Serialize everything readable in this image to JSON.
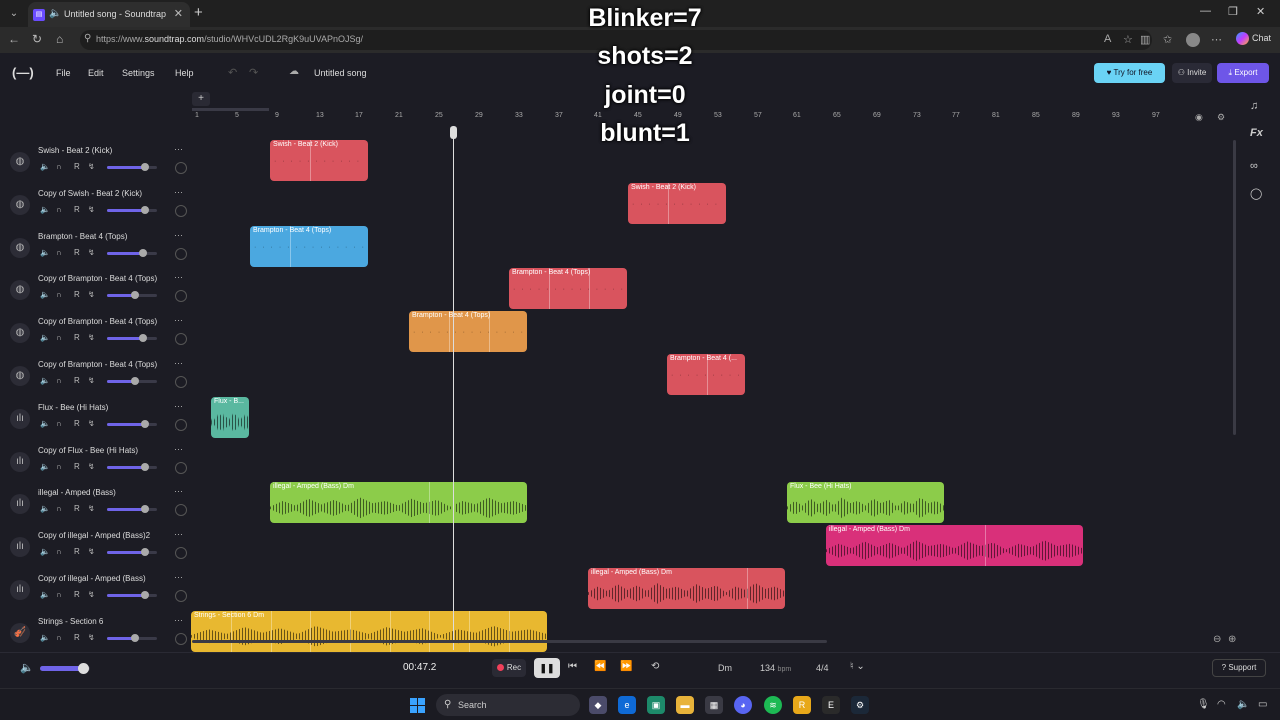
{
  "browser": {
    "tab_title": "Untitled song - Soundtrap",
    "url_prefix": "https://www.",
    "url_host": "soundtrap.com",
    "url_path": "/studio/WHVcUDL2RgK9uUVAPnOJSg/",
    "chat_label": "Chat"
  },
  "app": {
    "logo": "(—)",
    "menu": [
      "File",
      "Edit",
      "Settings",
      "Help"
    ],
    "song_name": "Untitled song",
    "try_free": "Try for free",
    "invite": "Invite",
    "export": "Export"
  },
  "overlay": [
    "Blinker=7",
    "shots=2",
    "joint=0",
    "blunt=1"
  ],
  "ruler": [
    "1",
    "5",
    "9",
    "13",
    "17",
    "21",
    "25",
    "29",
    "33",
    "37",
    "41",
    "45",
    "49",
    "53",
    "57",
    "61",
    "65",
    "69",
    "73",
    "77",
    "81",
    "85",
    "89",
    "93",
    "97"
  ],
  "tracks": [
    {
      "name": "Swish - Beat 2 (Kick)",
      "icon": "drum-icon",
      "volume": 0.75
    },
    {
      "name": "Copy of Swish - Beat 2 (Kick)",
      "icon": "drum-icon",
      "volume": 0.75
    },
    {
      "name": "Brampton - Beat 4 (Tops)",
      "icon": "drum-icon",
      "volume": 0.72
    },
    {
      "name": "Copy of Brampton - Beat 4 (Tops)",
      "icon": "drum-icon",
      "volume": 0.55
    },
    {
      "name": "Copy of Brampton - Beat 4 (Tops)",
      "icon": "drum-icon",
      "volume": 0.72
    },
    {
      "name": "Copy of Brampton - Beat 4 (Tops)",
      "icon": "drum-icon",
      "volume": 0.55
    },
    {
      "name": "Flux - Bee (Hi Hats)",
      "icon": "waveform-icon",
      "volume": 0.75
    },
    {
      "name": "Copy of Flux - Bee (Hi Hats)",
      "icon": "waveform-icon",
      "volume": 0.75
    },
    {
      "name": "illegal - Amped (Bass)",
      "icon": "waveform-icon",
      "volume": 0.75
    },
    {
      "name": "Copy of illegal - Amped (Bass)2",
      "icon": "waveform-icon",
      "volume": 0.75
    },
    {
      "name": "Copy of illegal - Amped (Bass)",
      "icon": "waveform-icon",
      "volume": 0.75
    },
    {
      "name": "Strings - Section 6",
      "icon": "strings-icon",
      "volume": 0.55
    }
  ],
  "regions": [
    {
      "label": "Swish - Beat 2 (Kick)",
      "color": "#d9545e",
      "kind": "beat"
    },
    {
      "label": "Swish - Beat 2 (Kick)",
      "color": "#d9545e",
      "kind": "beat"
    },
    {
      "label": "Brampton - Beat 4 (Tops)",
      "color": "#4ba8e0",
      "kind": "beat"
    },
    {
      "label": "Brampton - Beat 4 (Tops)",
      "color": "#d9545e",
      "kind": "beat"
    },
    {
      "label": "Brampton - Beat 4 (Tops)",
      "color": "#e0964a",
      "kind": "beat"
    },
    {
      "label": "Brampton - Beat 4 (...",
      "color": "#d9545e",
      "kind": "beat"
    },
    {
      "label": "Flux - B...",
      "color": "#5ab8a0",
      "kind": "audio"
    },
    {
      "label": "illegal - Amped (Bass) Dm",
      "color": "#8ccc4a",
      "kind": "audio"
    },
    {
      "label": "Flux - Bee (Hi Hats)",
      "color": "#8ccc4a",
      "kind": "audio"
    },
    {
      "label": "illegal - Amped (Bass) Dm",
      "color": "#d9307a",
      "kind": "audio"
    },
    {
      "label": "illegal - Amped (Bass) Dm",
      "color": "#d9545e",
      "kind": "audio"
    },
    {
      "label": "Strings - Section 6 Dm",
      "color": "#e8b830",
      "kind": "audio"
    }
  ],
  "transport": {
    "time": "00:47.2",
    "rec": "Rec",
    "key": "Dm",
    "bpm": "134",
    "bpm_unit": "bpm",
    "time_signature": "4/4",
    "support": "Support",
    "master_volume": 0.85
  },
  "taskbar": {
    "search": "Search"
  }
}
